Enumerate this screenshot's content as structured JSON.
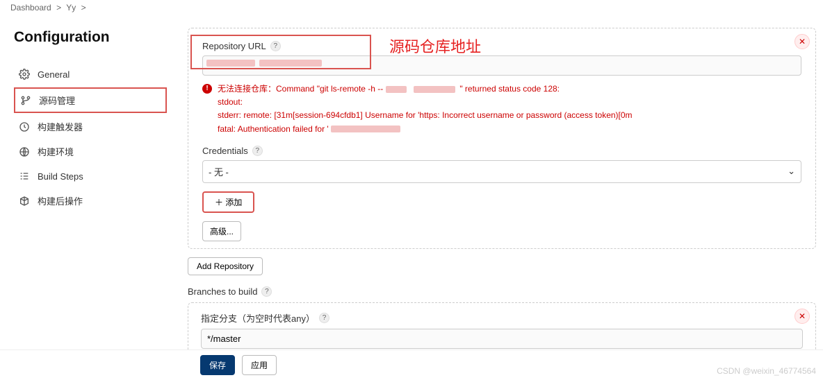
{
  "breadcrumb": {
    "item1": "Dashboard",
    "item2": "Yy",
    "sep": ">"
  },
  "sidebar": {
    "title": "Configuration",
    "items": [
      {
        "label": "General"
      },
      {
        "label": "源码管理"
      },
      {
        "label": "构建触发器"
      },
      {
        "label": "构建环境"
      },
      {
        "label": "Build Steps"
      },
      {
        "label": "构建后操作"
      }
    ]
  },
  "repo": {
    "label": "Repository URL",
    "value": "",
    "error": {
      "line1_prefix": "无法连接仓库：Command \"git ls-remote -h -- ",
      "line1_suffix": "\" returned status code 128:",
      "line2": "stdout:",
      "line3": "stderr: remote: \u001b[31m[session-694cfdb1] Username for 'https: Incorrect username or password (access token)\u001b[0m",
      "line4": "fatal: Authentication failed for '"
    }
  },
  "credentials": {
    "label": "Credentials",
    "value": "- 无 -"
  },
  "buttons": {
    "add": "添加",
    "advanced": "高级...",
    "add_repo": "Add Repository",
    "save": "保存",
    "apply": "应用"
  },
  "branches": {
    "section": "Branches to build",
    "label": "指定分支（为空时代表any）",
    "value": "*/master"
  },
  "annotation": {
    "repo_label": "源码仓库地址"
  },
  "watermark": "CSDN @weixin_46774564"
}
